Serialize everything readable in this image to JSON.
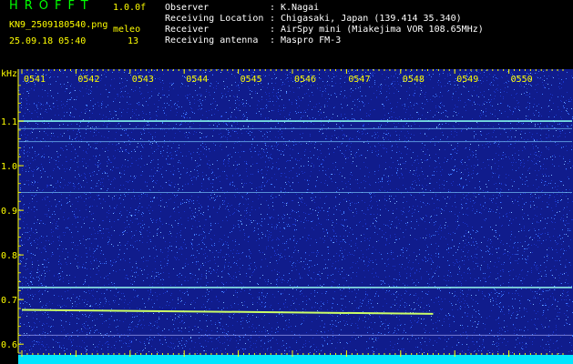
{
  "header": {
    "app_title": "HROFFT",
    "version": "1.0.0f",
    "filename": "KN9_2509180540.png",
    "datetime": "25.09.18 05:40",
    "meleo_label": "meleo",
    "meleo_count": "13",
    "info": [
      {
        "key": "Observer",
        "value": "K.Nagai"
      },
      {
        "key": "Receiving Location",
        "value": "Chigasaki, Japan (139.414 35.340)"
      },
      {
        "key": "Receiver",
        "value": "AirSpy mini (Miakejima VOR 108.65MHz)"
      },
      {
        "key": "Receiving antenna",
        "value": "Maspro FM-3"
      }
    ]
  },
  "spectrogram": {
    "y_unit": "kHz",
    "time_ticks": [
      "0541",
      "0542",
      "0543",
      "0544",
      "0545",
      "0546",
      "0547",
      "0548",
      "0549",
      "0550"
    ],
    "freq_ticks": [
      1.1,
      1.0,
      0.9,
      0.8,
      0.7,
      0.6
    ],
    "freq_range": [
      0.58,
      1.2
    ],
    "time_range": [
      0,
      10
    ],
    "carrier_lines": [
      {
        "freq": 1.1,
        "color": "#88ffee",
        "strength": 0.95
      },
      {
        "freq": 1.083,
        "color": "#7fd0ff",
        "strength": 0.4
      },
      {
        "freq": 1.054,
        "color": "#7fd0ff",
        "strength": 0.45
      },
      {
        "freq": 0.94,
        "color": "#7fd0ff",
        "strength": 0.4
      },
      {
        "freq": 0.727,
        "color": "#99ffee",
        "strength": 0.85
      },
      {
        "freq": 0.62,
        "color": "#bbbbff",
        "strength": 0.35
      }
    ],
    "meteor_trail": {
      "freq_start": 0.677,
      "freq_end": 0.668,
      "time_start": 0,
      "time_end": 7.6,
      "color": "#ccff66"
    },
    "colors": {
      "background": "#101c8c",
      "noise_dim": "#1a34c8",
      "noise_bright": "#3f7bff",
      "tick_color": "#ffff00",
      "label_color": "#ffff00",
      "bottom_band": "#00e5ff"
    }
  }
}
